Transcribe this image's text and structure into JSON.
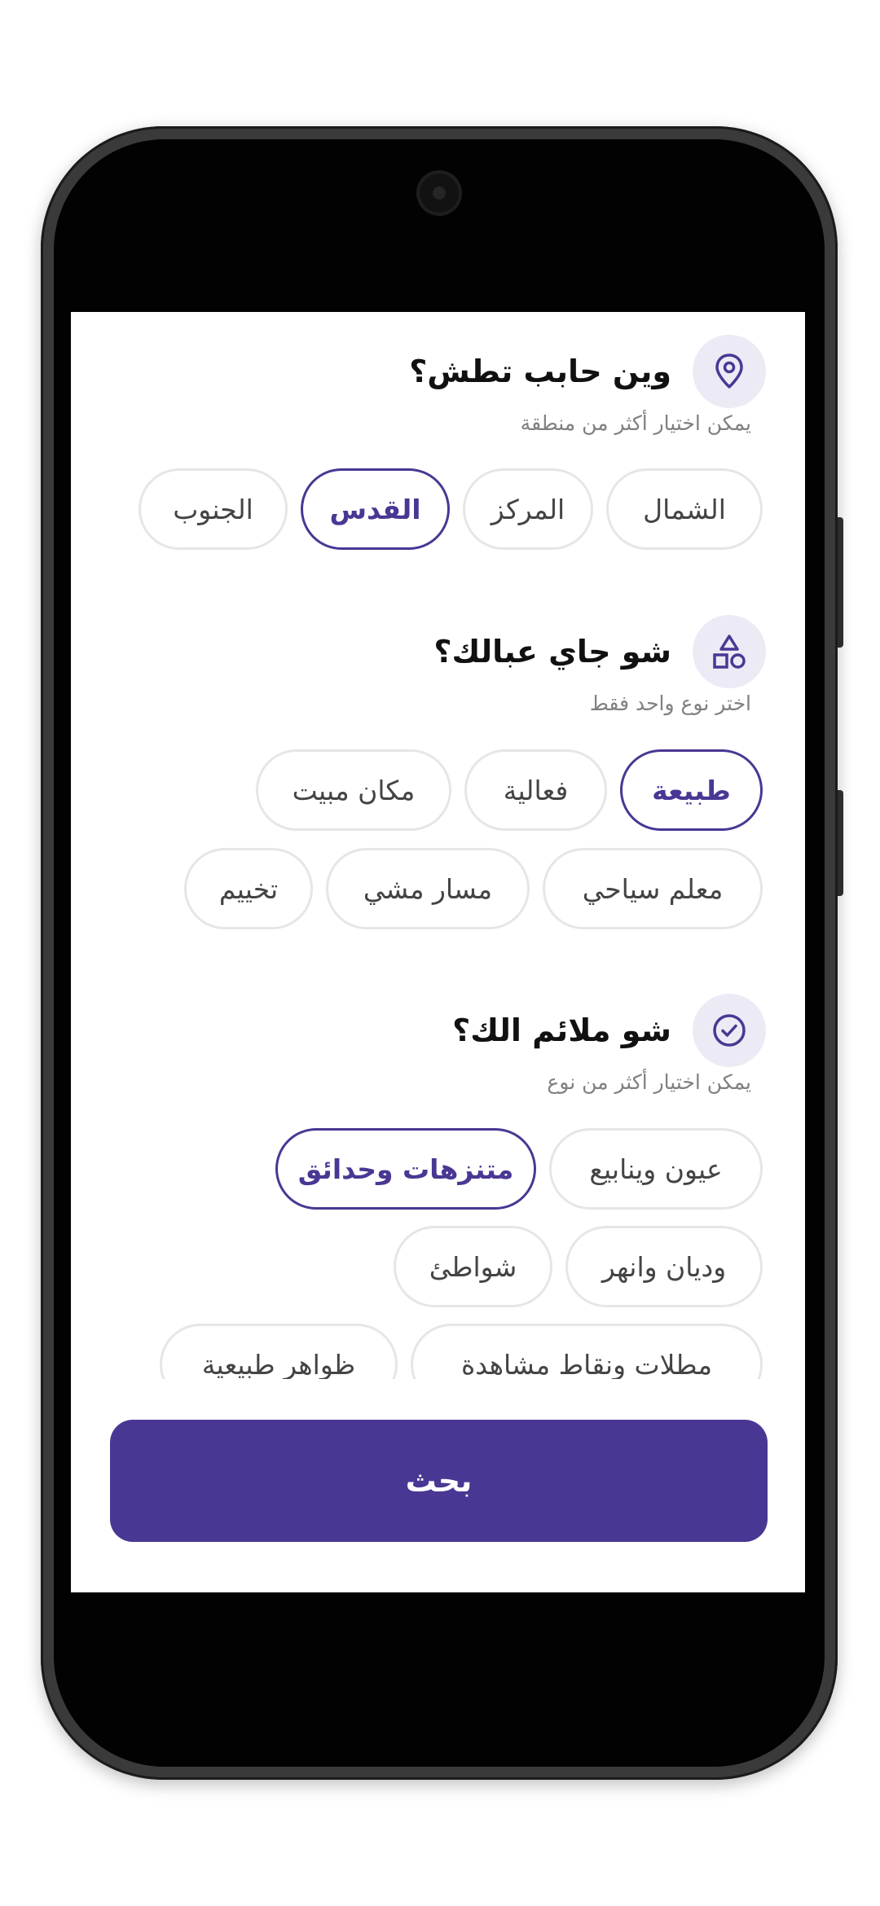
{
  "sections": [
    {
      "title": "وين حابب تطش؟",
      "subtitle": "يمكن اختيار أكثر من منطقة",
      "icon": "location-pin-icon",
      "rows": [
        [
          {
            "label": "الشمال",
            "selected": false
          },
          {
            "label": "المركز",
            "selected": false
          },
          {
            "label": "القدس",
            "selected": true
          },
          {
            "label": "الجنوب",
            "selected": false
          }
        ]
      ]
    },
    {
      "title": "شو جاي عبالك؟",
      "subtitle": "اختر نوع واحد فقط",
      "icon": "shapes-icon",
      "rows": [
        [
          {
            "label": "طبيعة",
            "selected": true
          },
          {
            "label": "فعالية",
            "selected": false
          },
          {
            "label": "مكان مبيت",
            "selected": false
          }
        ],
        [
          {
            "label": "معلم سياحي",
            "selected": false
          },
          {
            "label": "مسار مشي",
            "selected": false
          },
          {
            "label": "تخييم",
            "selected": false
          }
        ]
      ]
    },
    {
      "title": "شو ملائم الك؟",
      "subtitle": "يمكن اختيار أكثر من نوع",
      "icon": "check-circle-icon",
      "rows": [
        [
          {
            "label": "عيون وينابيع",
            "selected": false
          },
          {
            "label": "متنزهات وحدائق",
            "selected": true
          }
        ],
        [
          {
            "label": "وديان وانهر",
            "selected": false
          },
          {
            "label": "شواطئ",
            "selected": false
          }
        ],
        [
          {
            "label": "مطلات ونقاط مشاهدة",
            "selected": false
          },
          {
            "label": "ظواهر طبيعية",
            "selected": false
          }
        ]
      ]
    }
  ],
  "search_button": {
    "label": "بحث"
  },
  "colors": {
    "accent": "#4a3794",
    "icon_bg": "#ecebf5",
    "chip_border": "#e6e6e6",
    "subtitle": "#808080"
  }
}
